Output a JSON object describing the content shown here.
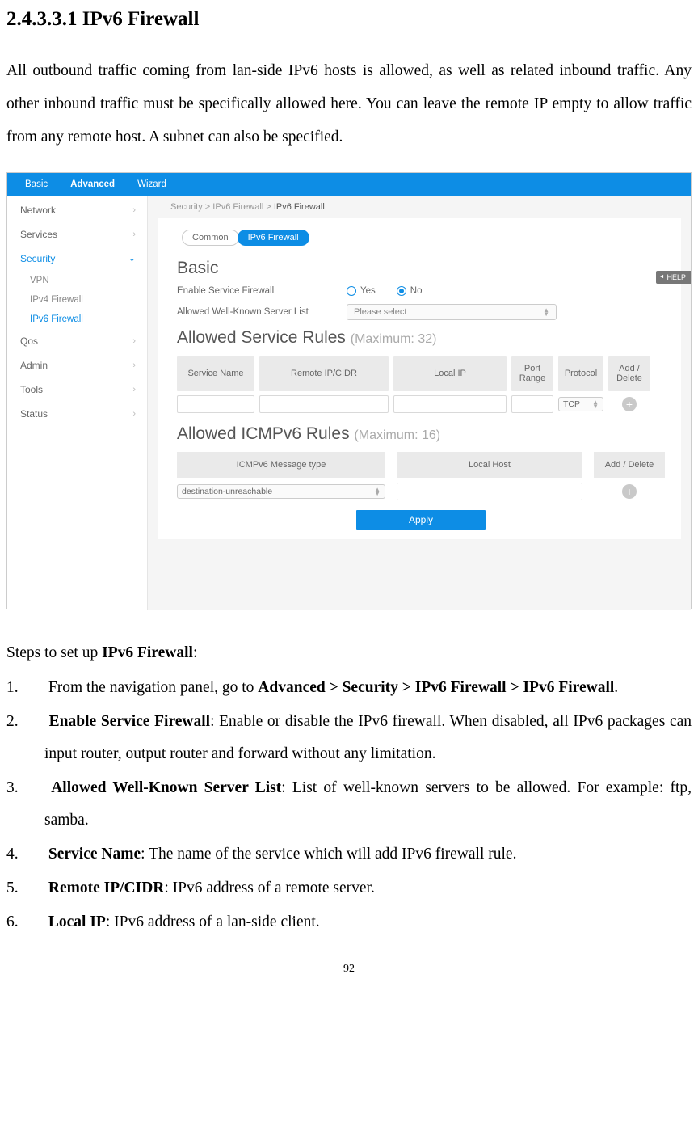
{
  "doc": {
    "heading": "2.4.3.3.1 IPv6 Firewall",
    "paragraph": "All outbound traffic coming from lan-side IPv6 hosts is allowed, as well as related inbound traffic. Any other inbound traffic must be specifically allowed here. You can leave the remote IP empty to allow traffic from any remote host. A subnet can also be specified.",
    "steps_intro_prefix": "Steps to set up ",
    "steps_intro_bold": "IPv6 Firewall",
    "steps_intro_suffix": ":",
    "steps": [
      {
        "prefix": "From the navigation panel, go to ",
        "bold": "Advanced > Security > IPv6 Firewall > IPv6 Firewall",
        "suffix": "."
      },
      {
        "bold": "Enable Service Firewall",
        "suffix": ": Enable or disable the IPv6 firewall. When disabled, all IPv6 packages can input router, output router and forward without any limitation."
      },
      {
        "bold": "Allowed Well-Known Server List",
        "suffix": ": List of well-known servers to be allowed. For example: ftp, samba."
      },
      {
        "bold": "Service Name",
        "suffix": ": The name of the service which will add IPv6 firewall rule."
      },
      {
        "bold": "Remote IP/CIDR",
        "suffix": ": IPv6 address of a remote server."
      },
      {
        "bold": "Local IP",
        "suffix": ": IPv6 address of a lan-side client."
      }
    ],
    "page_num": "92"
  },
  "ui": {
    "topnav": {
      "basic": "Basic",
      "advanced": "Advanced",
      "wizard": "Wizard"
    },
    "breadcrumb": {
      "p1": "Security",
      "p2": "IPv6 Firewall",
      "current": "IPv6 Firewall",
      "sep": " > "
    },
    "sidebar": {
      "network": "Network",
      "services": "Services",
      "security": "Security",
      "vpn": "VPN",
      "ipv4fw": "IPv4 Firewall",
      "ipv6fw": "IPv6 Firewall",
      "qos": "Qos",
      "admin": "Admin",
      "tools": "Tools",
      "status": "Status"
    },
    "tabs": {
      "common": "Common",
      "active": "IPv6 Firewall"
    },
    "basic": {
      "title": "Basic",
      "enable_label": "Enable Service Firewall",
      "yes": "Yes",
      "no": "No",
      "allowed_label": "Allowed Well-Known Server List",
      "select_placeholder": "Please select"
    },
    "rules": {
      "title": "Allowed Service Rules ",
      "title_muted": "(Maximum: 32)",
      "cols": {
        "sname": "Service Name",
        "rip": "Remote IP/CIDR",
        "lip": "Local IP",
        "port": "Port Range",
        "proto": "Protocol",
        "add": "Add / Delete"
      },
      "proto_value": "TCP"
    },
    "icmp": {
      "title": "Allowed ICMPv6 Rules ",
      "title_muted": "(Maximum: 16)",
      "cols": {
        "type": "ICMPv6 Message type",
        "host": "Local Host",
        "add": "Add / Delete"
      },
      "type_value": "destination-unreachable"
    },
    "apply": "Apply",
    "help": "HELP"
  }
}
